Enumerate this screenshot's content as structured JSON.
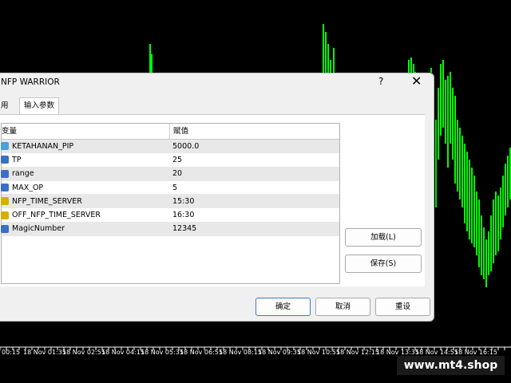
{
  "dialog": {
    "title": "NFP WARRIOR",
    "help_label": "?",
    "close_label": "✕",
    "tabs": [
      {
        "label": "用"
      },
      {
        "label": "输入参数"
      }
    ],
    "table": {
      "col_variable": "变量",
      "col_value": "赋值",
      "rows": [
        {
          "name": "KETAHANAN_PIP",
          "value": "5000.0",
          "icon": "double-param-icon"
        },
        {
          "name": "TP",
          "value": "25",
          "icon": "int-param-icon"
        },
        {
          "name": "range",
          "value": "20",
          "icon": "int-param-icon"
        },
        {
          "name": "MAX_OP",
          "value": "5",
          "icon": "int-param-icon"
        },
        {
          "name": "NFP_TIME_SERVER",
          "value": "15:30",
          "icon": "string-param-icon"
        },
        {
          "name": "OFF_NFP_TIME_SERVER",
          "value": "16:30",
          "icon": "string-param-icon"
        },
        {
          "name": "MagicNumber",
          "value": "12345",
          "icon": "int-param-icon"
        }
      ]
    },
    "load_label": "加载(L)",
    "save_label": "保存(S)",
    "ok_label": "确定",
    "cancel_label": "取消",
    "reset_label": "重设"
  },
  "time_axis": [
    "00:15",
    "18 Nov 01:35",
    "18 Nov 02:55",
    "18 Nov 04:15",
    "18 Nov 05:35",
    "18 Nov 06:55",
    "18 Nov 08:15",
    "18 Nov 09:35",
    "18 Nov 10:55",
    "18 Nov 12:15",
    "18 Nov 13:35",
    "18 Nov 14:55",
    "18 Nov 16:15"
  ],
  "watermark": "www.mt4.shop",
  "colors": {
    "candle": "#00ff00",
    "background": "#000000"
  }
}
